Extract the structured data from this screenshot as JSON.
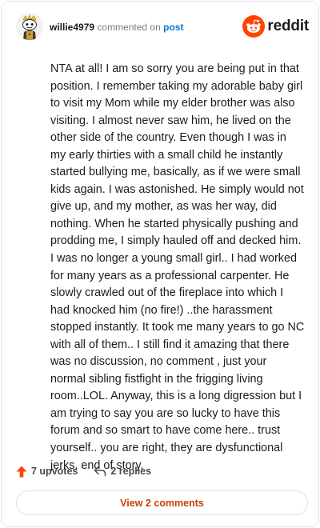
{
  "header": {
    "username": "willie4979",
    "verb": "commented on",
    "post_link": "post",
    "brand": "reddit",
    "avatar_icon": "snoo-avatar-icon",
    "brand_icon": "reddit-logo-icon"
  },
  "comment": {
    "text": "NTA at all! I am so sorry you are being put in that position. I remember taking my adorable baby girl to visit my Mom while my elder brother was also visiting. I almost never saw him, he lived on the other side of the country. Even though I was in my early thirties with a small child he instantly started bullying me, basically, as if we were small kids again. I was astonished. He simply would not give up, and my mother, as was her way, did nothing. When he started physically pushing and prodding me, I simply hauled off and decked him. I was no longer a young small girl.. I had worked for many years as a professional carpenter. He slowly crawled out of the fireplace into which I had knocked him (no fire!) ..the harassment stopped instantly. It took me many years to go NC with all of them.. I still find it amazing that there was no discussion, no comment , just your normal sibling fistfight in the frigging living room..LOL. Anyway, this is a long digression but I am trying to say you are so lucky to have this forum and so smart to have come here.. trust yourself.. you are right, they are dysfunctional jerks, end of story."
  },
  "actions": {
    "upvotes_label": "7 upvotes",
    "replies_label": "2 replies",
    "upvote_icon": "upvote-arrow-icon",
    "reply_icon": "reply-arrow-icon"
  },
  "view_comments_label": "View 2 comments",
  "colors": {
    "brand": "#ff4500",
    "link": "#0079d3",
    "view_button_text": "#cc3f00"
  }
}
